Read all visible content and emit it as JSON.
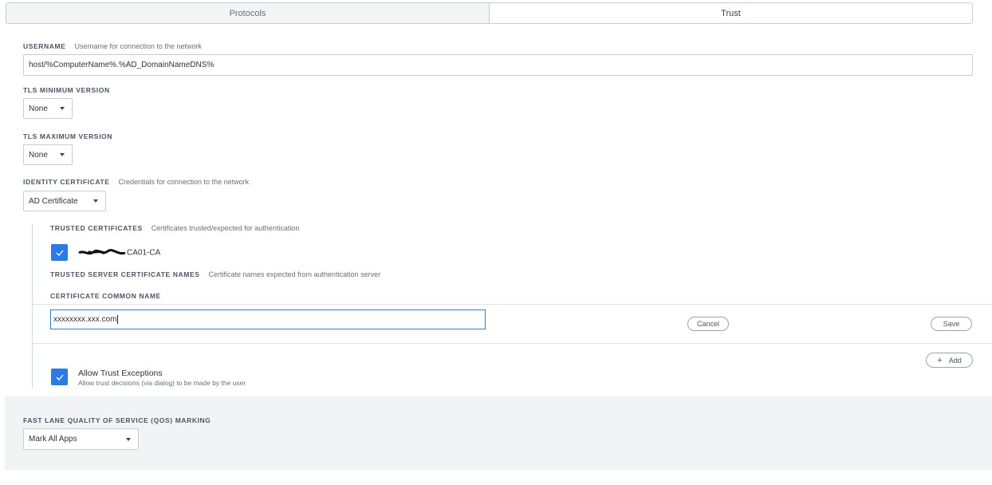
{
  "tabs": [
    {
      "label": "Protocols",
      "active": false
    },
    {
      "label": "Trust",
      "active": true
    }
  ],
  "username": {
    "label": "USERNAME",
    "description": "Username for connection to the network",
    "value": "host/%ComputerName%.%AD_DomainNameDNS%"
  },
  "tls_min": {
    "label": "TLS MINIMUM VERSION",
    "value": "None"
  },
  "tls_max": {
    "label": "TLS MAXIMUM VERSION",
    "value": "None"
  },
  "identity_certificate": {
    "label": "IDENTITY CERTIFICATE",
    "description": "Credentials for connection to the network",
    "value": "AD Certificate"
  },
  "trusted_certificates": {
    "label": "TRUSTED CERTIFICATES",
    "description": "Certificates trusted/expected for authentication",
    "item_visible_suffix": "CA01-CA",
    "checked": true
  },
  "trusted_server_names": {
    "label": "TRUSTED SERVER CERTIFICATE NAMES",
    "description": "Certificate names expected from authentication server",
    "column_header": "CERTIFICATE COMMON NAME",
    "input_value": "xxxxxxxx.xxx.com",
    "cancel_label": "Cancel",
    "save_label": "Save",
    "add_label": "Add"
  },
  "allow_trust_exceptions": {
    "title": "Allow Trust Exceptions",
    "description": "Allow trust decisions (via dialog) to be made by the user",
    "checked": true
  },
  "qos": {
    "label": "FAST LANE QUALITY OF SERVICE (QOS) MARKING",
    "value": "Mark All Apps"
  },
  "colors": {
    "accent": "#2c7be5",
    "focus_border": "#2f80c9",
    "section_bg": "#f2f3f5"
  }
}
